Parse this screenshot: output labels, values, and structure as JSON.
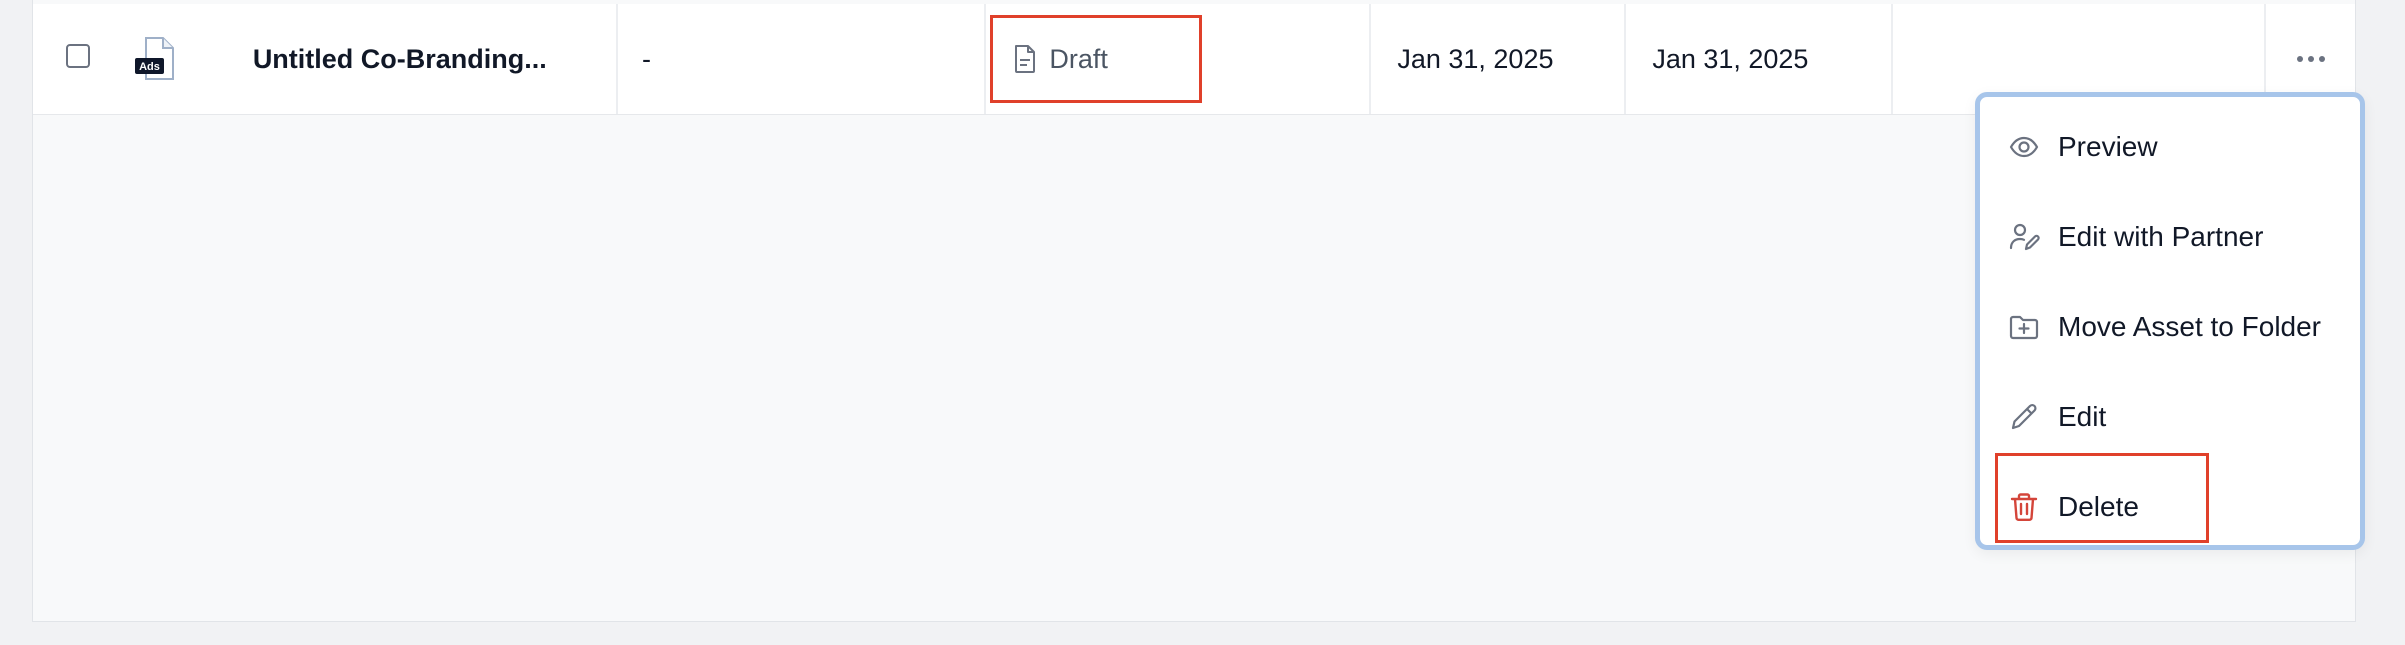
{
  "row": {
    "file_badge": "Ads",
    "name": "Untitled Co-Branding...",
    "placeholder_dash": "-",
    "status": "Draft",
    "date_1": "Jan 31, 2025",
    "date_2": "Jan 31, 2025"
  },
  "menu": {
    "items": [
      {
        "label": "Preview",
        "icon": "eye-icon"
      },
      {
        "label": "Edit with Partner",
        "icon": "user-pen-icon"
      },
      {
        "label": "Move Asset to Folder",
        "icon": "folder-plus-icon"
      },
      {
        "label": "Edit",
        "icon": "pencil-icon"
      },
      {
        "label": "Delete",
        "icon": "trash-icon"
      }
    ]
  },
  "colors": {
    "highlight_border": "#e0402a",
    "menu_border": "#a7c5ea",
    "delete_red": "#d4453a"
  }
}
